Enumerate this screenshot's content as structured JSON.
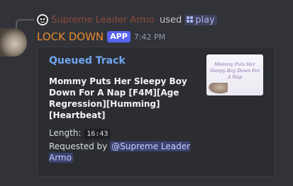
{
  "reply": {
    "username": "Supreme Leader Armo",
    "used_text": "used",
    "command": "play"
  },
  "message": {
    "bot_name": "LOCK DOWN",
    "badge": "APP",
    "timestamp": "7:42 PM"
  },
  "embed": {
    "title": "Queued Track",
    "description": "Mommy Puts Her Sleepy Boy Down For A Nap [F4M][Age Regression][Humming][Heartbeat]",
    "length_label": "Length:",
    "length_value": "16:43",
    "requested_label": "Requested by",
    "requested_user": "@Supreme Leader Armo",
    "thumbnail_text": "Mommy Puts Her Sleepy Boy Down For A Nap"
  },
  "colors": {
    "background": "#323339",
    "embed_bg": "#2b2d31",
    "bot_name": "#ea8b2d",
    "link": "#72a6f2",
    "badge": "#5865f2",
    "mention_bg": "#3c4270"
  }
}
